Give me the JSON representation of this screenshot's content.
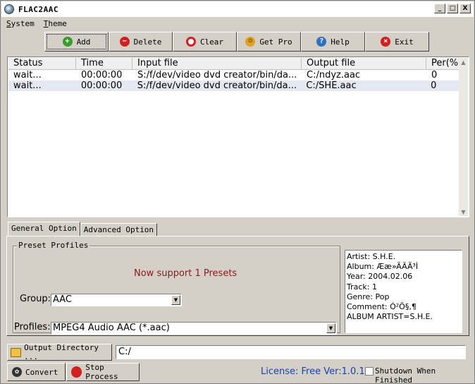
{
  "window": {
    "title": "FLAC2AAC",
    "controls": [
      "_",
      "□",
      "X"
    ]
  },
  "menu": [
    "System",
    "Theme"
  ],
  "toolbar": [
    {
      "label": "Add",
      "icon": "add-icon",
      "color": "#3a9a2a"
    },
    {
      "label": "Delete",
      "icon": "delete-icon",
      "color": "#d02020"
    },
    {
      "label": "Clear",
      "icon": "clear-icon",
      "color": "#d02020"
    },
    {
      "label": "Get Pro",
      "icon": "smile-icon",
      "color": "#e0a020"
    },
    {
      "label": "Help",
      "icon": "help-icon",
      "color": "#3070c0"
    },
    {
      "label": "Exit",
      "icon": "exit-icon",
      "color": "#d02020"
    }
  ],
  "list": {
    "columns": [
      "Status",
      "Time",
      "Input file",
      "Output file",
      "Per(%"
    ],
    "rows": [
      {
        "status": "wait...",
        "time": "00:00:00",
        "input": "S:/f/dev/video dvd creator/bin/da...",
        "output": "C:/ndyz.aac",
        "per": "0"
      },
      {
        "status": "wait...",
        "time": "00:00:00",
        "input": "S:/f/dev/video dvd creator/bin/da...",
        "output": "C:/SHE.aac",
        "per": "0"
      }
    ]
  },
  "tabs": [
    "General Option",
    "Advanced Option"
  ],
  "presets": {
    "group_label": "Preset Profiles",
    "support_text": "Now support 1 Presets",
    "group_field_label": "Group:",
    "group_value": "AAC",
    "profiles_field_label": "Profiles:",
    "profiles_value": "MPEG4 Audio AAC (*.aac)"
  },
  "info_lines": [
    "Artist:  S.H.E.",
    "Album:  Ææ»ÃÃÃ³Ì",
    "Year:    2004.02.06",
    "Track:   1",
    "Genre:   Pop",
    "Comment: Ó²Ö§,¶",
    "ALBUM ARTIST=S.H.E."
  ],
  "output": {
    "button_label": "Output Directory ...",
    "path": "C:/"
  },
  "bottom": {
    "convert_label": "Convert",
    "stop_label": "Stop Process",
    "license_text": "License: Free Ver:1.0.1",
    "shutdown_label": "Shutdown When Finished"
  }
}
